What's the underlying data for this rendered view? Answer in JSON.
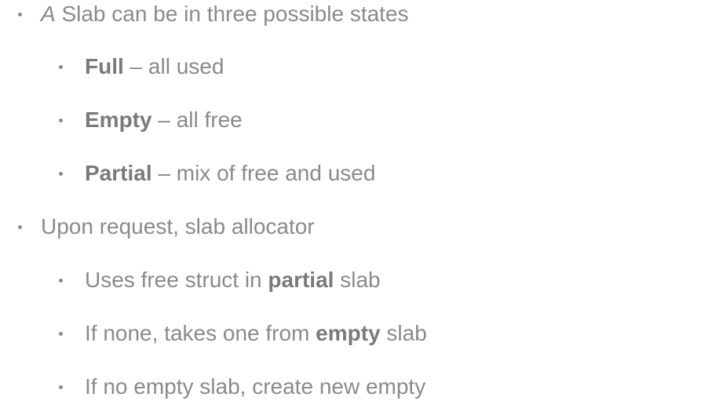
{
  "bullets": [
    {
      "level": 1,
      "parts": [
        {
          "text": "A",
          "style": "italic"
        },
        {
          "text": " Slab can be in three possible states",
          "style": "normal"
        }
      ]
    },
    {
      "level": 2,
      "parts": [
        {
          "text": "Full",
          "style": "bold"
        },
        {
          "text": " – all used",
          "style": "normal"
        }
      ]
    },
    {
      "level": 2,
      "parts": [
        {
          "text": "Empty",
          "style": "bold"
        },
        {
          "text": " – all free",
          "style": "normal"
        }
      ]
    },
    {
      "level": 2,
      "parts": [
        {
          "text": "Partial",
          "style": "bold"
        },
        {
          "text": " – mix of free and used",
          "style": "normal"
        }
      ]
    },
    {
      "level": 1,
      "parts": [
        {
          "text": "Upon request, slab allocator",
          "style": "normal"
        }
      ]
    },
    {
      "level": 2,
      "parts": [
        {
          "text": "Uses free struct in ",
          "style": "normal"
        },
        {
          "text": "partial",
          "style": "bold"
        },
        {
          "text": " slab",
          "style": "normal"
        }
      ]
    },
    {
      "level": 2,
      "parts": [
        {
          "text": "If none, takes one from ",
          "style": "normal"
        },
        {
          "text": "empty",
          "style": "bold"
        },
        {
          "text": " slab",
          "style": "normal"
        }
      ]
    },
    {
      "level": 2,
      "parts": [
        {
          "text": "If no empty slab, create new empty",
          "style": "normal"
        }
      ]
    }
  ],
  "colors": {
    "text": "#8a8a8a",
    "bold_text": "#7a7a7a",
    "background": "#ffffff"
  }
}
